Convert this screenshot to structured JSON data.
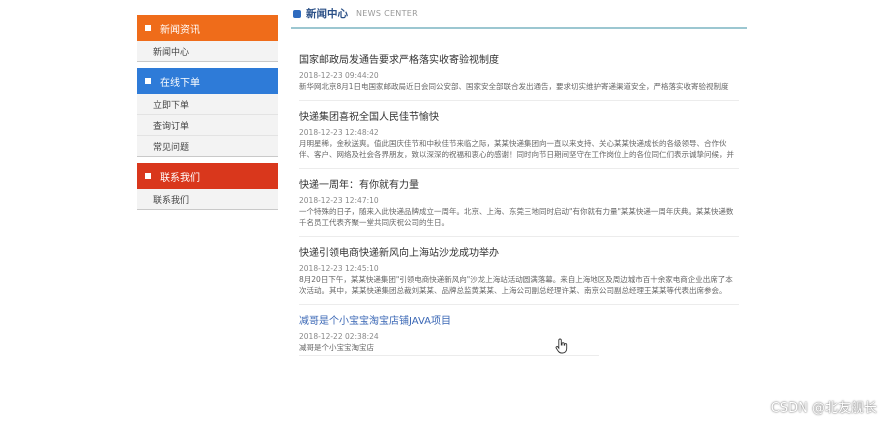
{
  "sidebar": {
    "groups": [
      {
        "title": "新闻资讯",
        "color": "#ef6c1a",
        "items": [
          "新闻中心"
        ]
      },
      {
        "title": "在线下单",
        "color": "#2e7bd8",
        "items": [
          "立即下单",
          "查询订单",
          "常见问题"
        ]
      },
      {
        "title": "联系我们",
        "color": "#d9371c",
        "items": [
          "联系我们"
        ]
      }
    ]
  },
  "main": {
    "header_title": "新闻中心",
    "header_sub": "NEWS CENTER",
    "news": [
      {
        "title": "国家邮政局发通告要求严格落实收寄验视制度",
        "date": "2018-12-23 09:44:20",
        "summary": "新华网北京8月1日电国家邮政局近日会同公安部、国家安全部联合发出通告，要求切实维护寄递渠道安全，严格落实收寄验视制度"
      },
      {
        "title": "快递集团喜祝全国人民佳节愉快",
        "date": "2018-12-23 12:48:42",
        "summary": "月明星稀，金秋送爽。值此国庆佳节和中秋佳节来临之际，某某快递集团向一直以来支持、关心某某快递成长的各级领导、合作伙伴、客户、网络及社会各界朋友，致以深深的祝福和衷心的感谢！同时向节日期间坚守在工作岗位上的各位同仁们表示诚挚问候，并致以"
      },
      {
        "title": "快递一周年：有你就有力量",
        "date": "2018-12-23 12:47:10",
        "summary": "一个特殊的日子，随来入此快递品牌成立一周年。北京、上海、东莞三地同时启动\"有你就有力量\"某某快递一周年庆典。某某快递数千名员工代表齐聚一堂共同庆祝公司的生日。"
      },
      {
        "title": "快递引领电商快递新风向上海站沙龙成功举办",
        "date": "2018-12-23 12:45:10",
        "summary": "8月20日下午，某某快递集团\"引领电商快递新风向\"沙龙上海站活动圆满落幕。来自上海地区及周边城市百十余家电商企业出席了本次活动。其中，某某快递集团总裁刘某某、品牌总监黄某某、上海公司副总经理许某、南京公司副总经理王某某等代表出席参会。"
      },
      {
        "title": "减哥是个小宝宝淘宝店铺JAVA项目",
        "date": "2018-12-22 02:38:24",
        "summary": "减哥是个小宝宝淘宝店"
      }
    ]
  },
  "watermark": "CSDN @北友舰长"
}
